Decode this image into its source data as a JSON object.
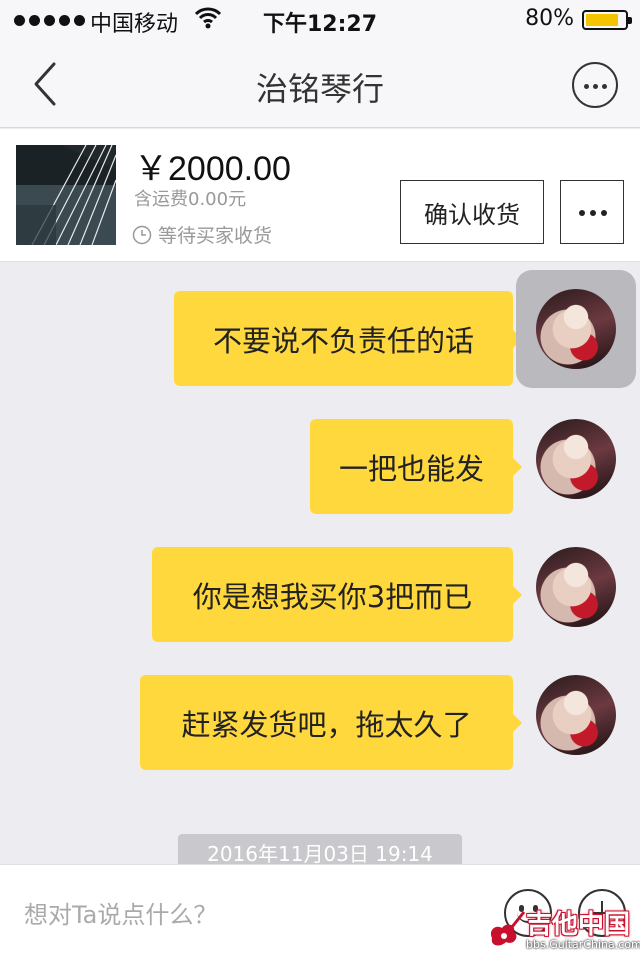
{
  "status_bar": {
    "carrier": "中国移动",
    "time": "下午12:27",
    "battery_percent": "80%",
    "battery_level": 0.8,
    "battery_color": "#f5c400"
  },
  "nav": {
    "title": "治铭琴行",
    "back_icon": "chevron-left-icon",
    "more_icon": "ellipsis-circle-icon"
  },
  "product": {
    "price": "￥2000.00",
    "shipping": "含运费0.00元",
    "status": "等待买家收货",
    "confirm_label": "确认收货",
    "more_icon": "ellipsis-icon"
  },
  "messages": [
    {
      "text": "不要说不负责任的话",
      "sender": "self"
    },
    {
      "text": "一把也能发",
      "sender": "self"
    },
    {
      "text": "你是想我买你3把而已",
      "sender": "self"
    },
    {
      "text": "赶紧发货吧，拖太久了",
      "sender": "self"
    }
  ],
  "timestamp": "2016年11月03日 19:14",
  "input": {
    "placeholder": "想对Ta说点什么？",
    "value": "",
    "emoji_icon": "smiley-icon",
    "plus_icon": "plus-circle-icon"
  },
  "watermark": {
    "title": "吉他中国",
    "subtitle": "bbs.GuitarChina.com"
  },
  "colors": {
    "bubble": "#ffd83d",
    "background": "#ececf1",
    "brand_red": "#c8102e"
  }
}
